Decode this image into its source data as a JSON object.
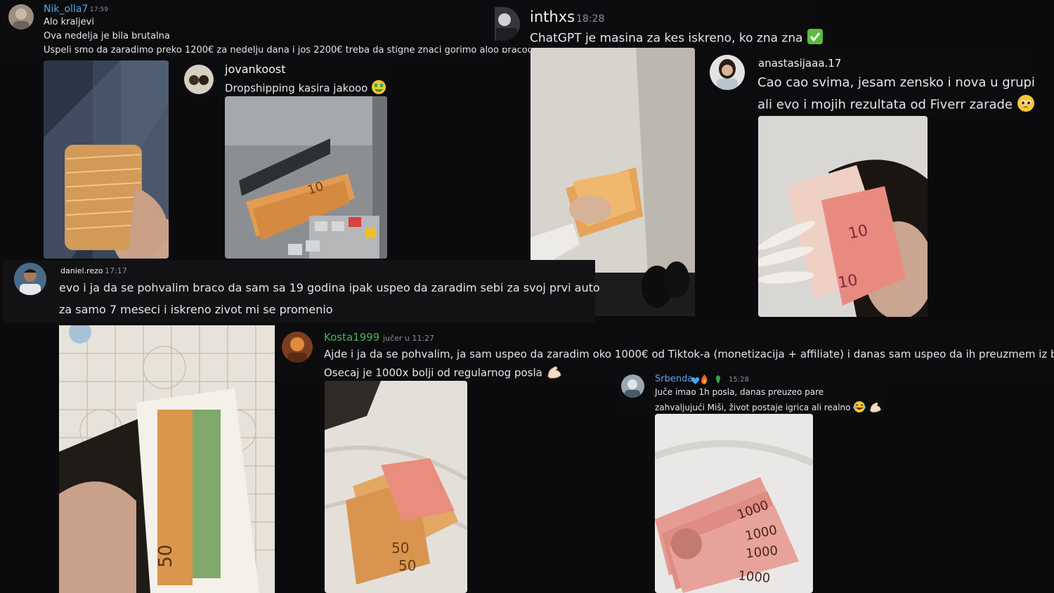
{
  "messages": [
    {
      "user": "Nik_olla7",
      "time": "17:59",
      "lines": [
        "Alo kraljevi",
        "Ova nedelja je bila brutalna",
        "Uspeli smo da zaradimo preko 1200€ za nedelju dana i jos 2200€ treba da stigne znaci gorimo aloo bracoo"
      ]
    },
    {
      "user": "jovankoost",
      "time": "",
      "lines": [
        "Dropshipping kasira jakooo"
      ],
      "emoji": "money-mouth-face-icon"
    },
    {
      "user": "inthxs",
      "time": "18:28",
      "lines": [
        "ChatGPT je masina za kes iskreno, ko zna zna"
      ],
      "emoji": "check-mark-icon"
    },
    {
      "user": "anastasijaaa.17",
      "time": "",
      "lines": [
        "Cao cao svima, jesam zensko i nova u grupi",
        "ali evo i mojih rezultata od Fiverr zarade"
      ],
      "emoji": "pleading-face-icon"
    },
    {
      "user": "daniel.rezo",
      "time": "17:17",
      "lines": [
        "evo i ja da se pohvalim braco da sam sa 19 godina ipak uspeo da zaradim sebi za svoj prvi auto",
        "za samo 7 meseci i iskreno zivot mi se promenio"
      ]
    },
    {
      "user": "Kosta1999",
      "time": "jučer u 11:27",
      "lines": [
        "Ajde i ja da se pohvalim, ja sam uspeo da zaradim oko 1000€ od Tiktok-a (monetizacija + affiliate) i danas sam uspeo da ih preuzmem iz banke",
        "Osecaj je 1000x bolji od regularnog posla"
      ],
      "emoji": "flexed-biceps-icon"
    },
    {
      "user": "Srbenda",
      "time": "15:28",
      "lines": [
        "Juče imao 1h posla, danas preuzeo pare",
        "zahvaljujući Miši, život postaje igrica ali realno"
      ],
      "emoji": "laughing-tears-icon"
    }
  ],
  "colors": {
    "background": "#0b0b0d",
    "username_blue": "#5aa3e6",
    "username_green": "#3fb950",
    "username_white": "#f2f3f5",
    "text": "#e3e5e8",
    "timestamp": "#8b8f96"
  }
}
